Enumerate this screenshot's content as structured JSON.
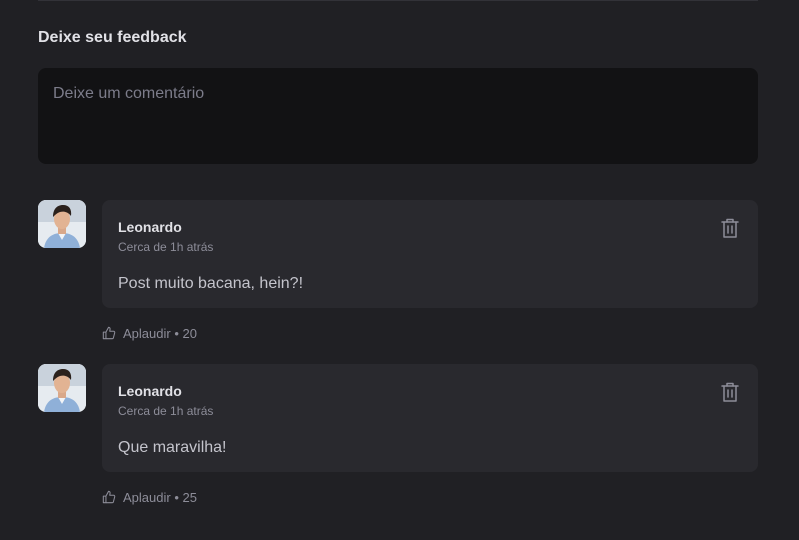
{
  "feedback": {
    "title": "Deixe seu feedback",
    "placeholder": "Deixe um comentário",
    "value": ""
  },
  "comments": [
    {
      "author": "Leonardo",
      "time": "Cerca de 1h atrás",
      "text": "Post muito bacana, hein?!",
      "applaud_label": "Aplaudir",
      "separator": "•",
      "applaud_count": "20"
    },
    {
      "author": "Leonardo",
      "time": "Cerca de 1h atrás",
      "text": "Que maravilha!",
      "applaud_label": "Aplaudir",
      "separator": "•",
      "applaud_count": "25"
    }
  ],
  "icons": {
    "delete": "trash-icon",
    "applaud": "thumbs-up-icon"
  },
  "colors": {
    "background": "#202024",
    "input_background": "#121214",
    "card_background": "#29292E",
    "text": "#E1E1E6",
    "muted": "#8D8D99"
  }
}
